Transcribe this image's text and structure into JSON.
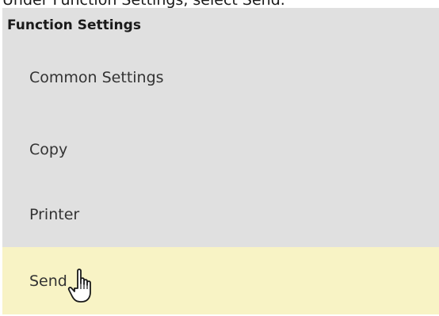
{
  "instruction": "Under Function Settings, select Send.",
  "panel": {
    "header": "Function Settings",
    "items": [
      {
        "label": "Common Settings"
      },
      {
        "label": "Copy"
      },
      {
        "label": "Printer"
      },
      {
        "label": "Send"
      }
    ],
    "highlight_color": "#f8f3c5",
    "background_color": "#e0e0e0"
  },
  "cursor": {
    "icon": "hand-pointer-icon"
  }
}
